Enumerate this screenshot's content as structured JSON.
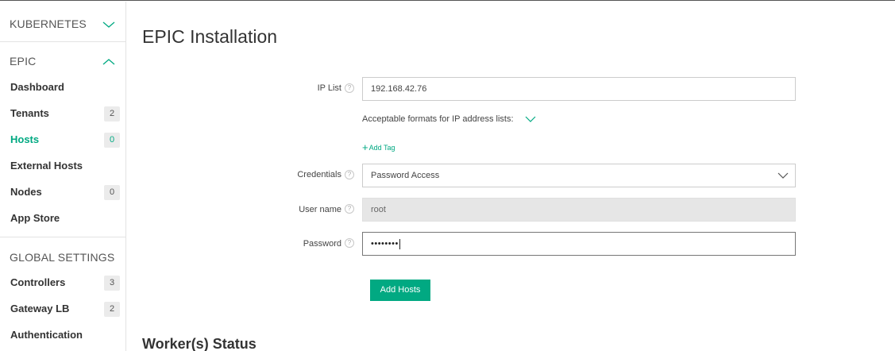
{
  "sidebar": {
    "kubernetes_title": "KUBERNETES",
    "epic_title": "EPIC",
    "global_title": "GLOBAL SETTINGS",
    "epic_items": [
      {
        "label": "Dashboard",
        "count": null
      },
      {
        "label": "Tenants",
        "count": "2"
      },
      {
        "label": "Hosts",
        "count": "0",
        "active": true
      },
      {
        "label": "External Hosts",
        "count": null
      },
      {
        "label": "Nodes",
        "count": "0"
      },
      {
        "label": "App Store",
        "count": null
      }
    ],
    "global_items": [
      {
        "label": "Controllers",
        "count": "3"
      },
      {
        "label": "Gateway LB",
        "count": "2"
      },
      {
        "label": "Authentication",
        "count": null
      }
    ]
  },
  "main": {
    "title": "EPIC Installation",
    "workers_title": "Worker(s) Status",
    "form": {
      "ip_list_label": "IP List",
      "ip_list_value": "192.168.42.76",
      "formats_text": "Acceptable formats for IP address lists:",
      "add_tag_label": "Add Tag",
      "credentials_label": "Credentials",
      "credentials_value": "Password Access",
      "username_label": "User name",
      "username_value": "root",
      "password_label": "Password",
      "password_dots": "••••••••",
      "help_glyph": "?",
      "add_hosts_label": "Add Hosts"
    }
  },
  "colors": {
    "accent": "#01a982",
    "badge_bg": "#ebebeb",
    "disabled_bg": "#e6e6e6"
  }
}
